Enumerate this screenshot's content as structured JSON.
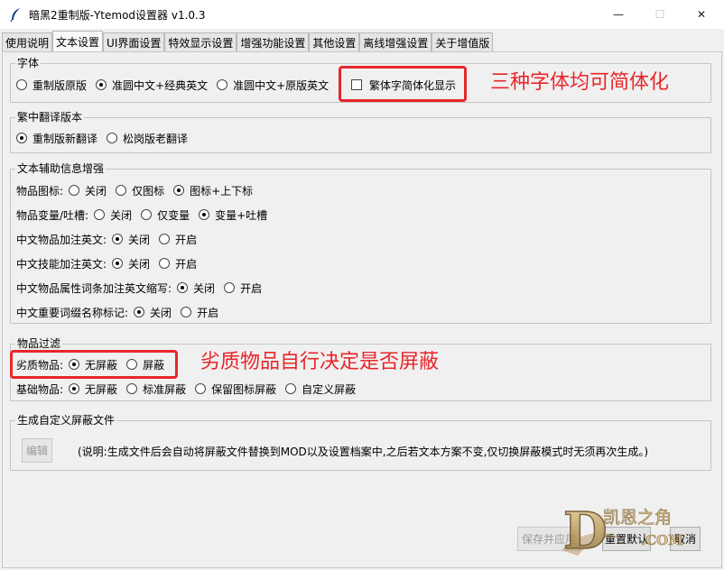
{
  "window": {
    "title": "暗黑2重制版-Ytemod设置器 v1.0.3",
    "minimize_glyph": "—",
    "maximize_glyph": "☐",
    "close_glyph": "✕"
  },
  "tabs": [
    {
      "label": "使用说明",
      "active": false
    },
    {
      "label": "文本设置",
      "active": true
    },
    {
      "label": "UI界面设置",
      "active": false
    },
    {
      "label": "特效显示设置",
      "active": false
    },
    {
      "label": "增强功能设置",
      "active": false
    },
    {
      "label": "其他设置",
      "active": false
    },
    {
      "label": "离线增强设置",
      "active": false
    },
    {
      "label": "关于增值版",
      "active": false
    }
  ],
  "font_group": {
    "title": "字体",
    "options": [
      {
        "label": "重制版原版",
        "selected": false
      },
      {
        "label": "准圆中文+经典英文",
        "selected": true
      },
      {
        "label": "准圆中文+原版英文",
        "selected": false
      }
    ],
    "checkbox_label": "繁体字简体化显示",
    "checkbox_checked": false
  },
  "translation_group": {
    "title": "繁中翻译版本",
    "options": [
      {
        "label": "重制版新翻译",
        "selected": true
      },
      {
        "label": "松岗版老翻译",
        "selected": false
      }
    ]
  },
  "assist_group": {
    "title": "文本辅助信息增强",
    "rows": [
      {
        "label": "物品图标:",
        "options": [
          {
            "label": "关闭",
            "selected": false
          },
          {
            "label": "仅图标",
            "selected": false
          },
          {
            "label": "图标+上下标",
            "selected": true
          }
        ]
      },
      {
        "label": "物品变量/吐槽:",
        "options": [
          {
            "label": "关闭",
            "selected": false
          },
          {
            "label": "仅变量",
            "selected": false
          },
          {
            "label": "变量+吐槽",
            "selected": true
          }
        ]
      },
      {
        "label": "中文物品加注英文:",
        "options": [
          {
            "label": "关闭",
            "selected": true
          },
          {
            "label": "开启",
            "selected": false
          }
        ]
      },
      {
        "label": "中文技能加注英文:",
        "options": [
          {
            "label": "关闭",
            "selected": true
          },
          {
            "label": "开启",
            "selected": false
          }
        ]
      },
      {
        "label": "中文物品属性词条加注英文缩写:",
        "options": [
          {
            "label": "关闭",
            "selected": true
          },
          {
            "label": "开启",
            "selected": false
          }
        ]
      },
      {
        "label": "中文重要词缀名称标记:",
        "options": [
          {
            "label": "关闭",
            "selected": true
          },
          {
            "label": "开启",
            "selected": false
          }
        ]
      }
    ]
  },
  "filter_group": {
    "title": "物品过滤",
    "rows": [
      {
        "label": "劣质物品:",
        "options": [
          {
            "label": "无屏蔽",
            "selected": true
          },
          {
            "label": "屏蔽",
            "selected": false
          }
        ]
      },
      {
        "label": "基础物品:",
        "options": [
          {
            "label": "无屏蔽",
            "selected": true
          },
          {
            "label": "标准屏蔽",
            "selected": false
          },
          {
            "label": "保留图标屏蔽",
            "selected": false
          },
          {
            "label": "自定义屏蔽",
            "selected": false
          }
        ]
      }
    ]
  },
  "generate_group": {
    "title": "生成自定义屏蔽文件",
    "edit_button": "编辑",
    "note": "(说明:生成文件后会自动将屏蔽文件替换到MOD以及设置档案中,之后若文本方案不变,仅切换屏蔽模式时无须再次生成。)"
  },
  "buttons": {
    "save_apply": "保存并应用",
    "reset_default": "重置默认",
    "cancel": "取消"
  },
  "annotations": {
    "font_note": "三种字体均可简体化",
    "filter_note": "劣质物品自行决定是否屏蔽"
  },
  "watermark": {
    "logo_letter": "D",
    "site_name": "凯恩之角",
    "site_suffix": ".COM"
  },
  "colors": {
    "annotation_red": "#e8262b",
    "panel_bg": "#f0f0f0",
    "watermark_gold": "#c9a86a"
  }
}
